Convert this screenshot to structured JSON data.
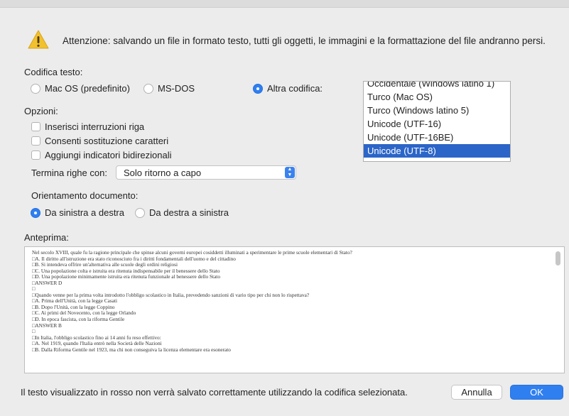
{
  "warning": {
    "icon": "warning-triangle-icon",
    "text": "Attenzione: salvando un file in formato testo, tutti gli oggetti, le immagini e la formattazione del file andranno persi."
  },
  "encoding": {
    "label": "Codifica testo:",
    "options": [
      "Mac OS (predefinito)",
      "MS-DOS",
      "Altra codifica:"
    ],
    "selected": "Altra codifica:",
    "list": [
      "Occidentale (Windows latino 1)",
      "Turco (Mac OS)",
      "Turco (Windows latino 5)",
      "Unicode (UTF-16)",
      "Unicode (UTF-16BE)",
      "Unicode (UTF-8)"
    ],
    "list_selected": "Unicode (UTF-8)"
  },
  "options": {
    "label": "Opzioni:",
    "checkboxes": [
      "Inserisci interruzioni riga",
      "Consenti sostituzione caratteri",
      "Aggiungi indicatori bidirezionali"
    ],
    "line_end_label": "Termina righe con:",
    "line_end_value": "Solo ritorno a capo",
    "orientation_label": "Orientamento documento:",
    "orientation_options": [
      "Da sinistra a destra",
      "Da destra a sinistra"
    ],
    "orientation_selected": "Da sinistra a destra"
  },
  "preview": {
    "label": "Anteprima:",
    "lines": [
      "Nel secolo XVIII, quale fu la ragione principale che spinse alcuni governi europei cosiddetti illuminati a sperimentare le prime scuole elementari di Stato?",
      "□A. Il diritto all'istruzione era stato riconosciuto fra i diritti fondamentali dell'uomo e del cittadino",
      "□B. Si intendeva offrire un'alternativa alle scuole degli ordini religiosi",
      "□C. Una popolazione colta e istruita era ritenuta indispensabile per il benessere dello Stato",
      "□D. Una popolazione minimamente istruita era ritenuta funzionale al benessere dello Stato",
      "□ANSWER D",
      "□",
      "□Quando venne per la prima volta introdotto l'obbligo scolastico in Italia, prevedendo sanzioni di vario tipo per chi non lo rispettava?",
      "□A. Prima dell'Unità, con la legge Casati",
      "□B. Dopo l'Unità, con la legge Coppino",
      "□C. Ai primi del Novecento, con la legge Orlando",
      "□D. In epoca fascista, con la riforma Gentile",
      "□ANSWER B",
      "□",
      "□In Italia, l'obbligo scolastico fino ai 14 anni fu reso effettivo:",
      "□A. Nel 1919, quando l'Italia entrò nella Società delle Nazioni",
      "□B. Dalla Riforma Gentile nel 1923, ma chi non conseguiva la licenza elementare era esonerato"
    ]
  },
  "footer": {
    "note": "Il testo visualizzato in rosso non verrà salvato correttamente utilizzando la codifica selezionata.",
    "cancel_label": "Annulla",
    "ok_label": "OK"
  },
  "colors": {
    "accent": "#2f7ff0",
    "selection": "#2c65c8",
    "warning": "#f2c12e"
  }
}
